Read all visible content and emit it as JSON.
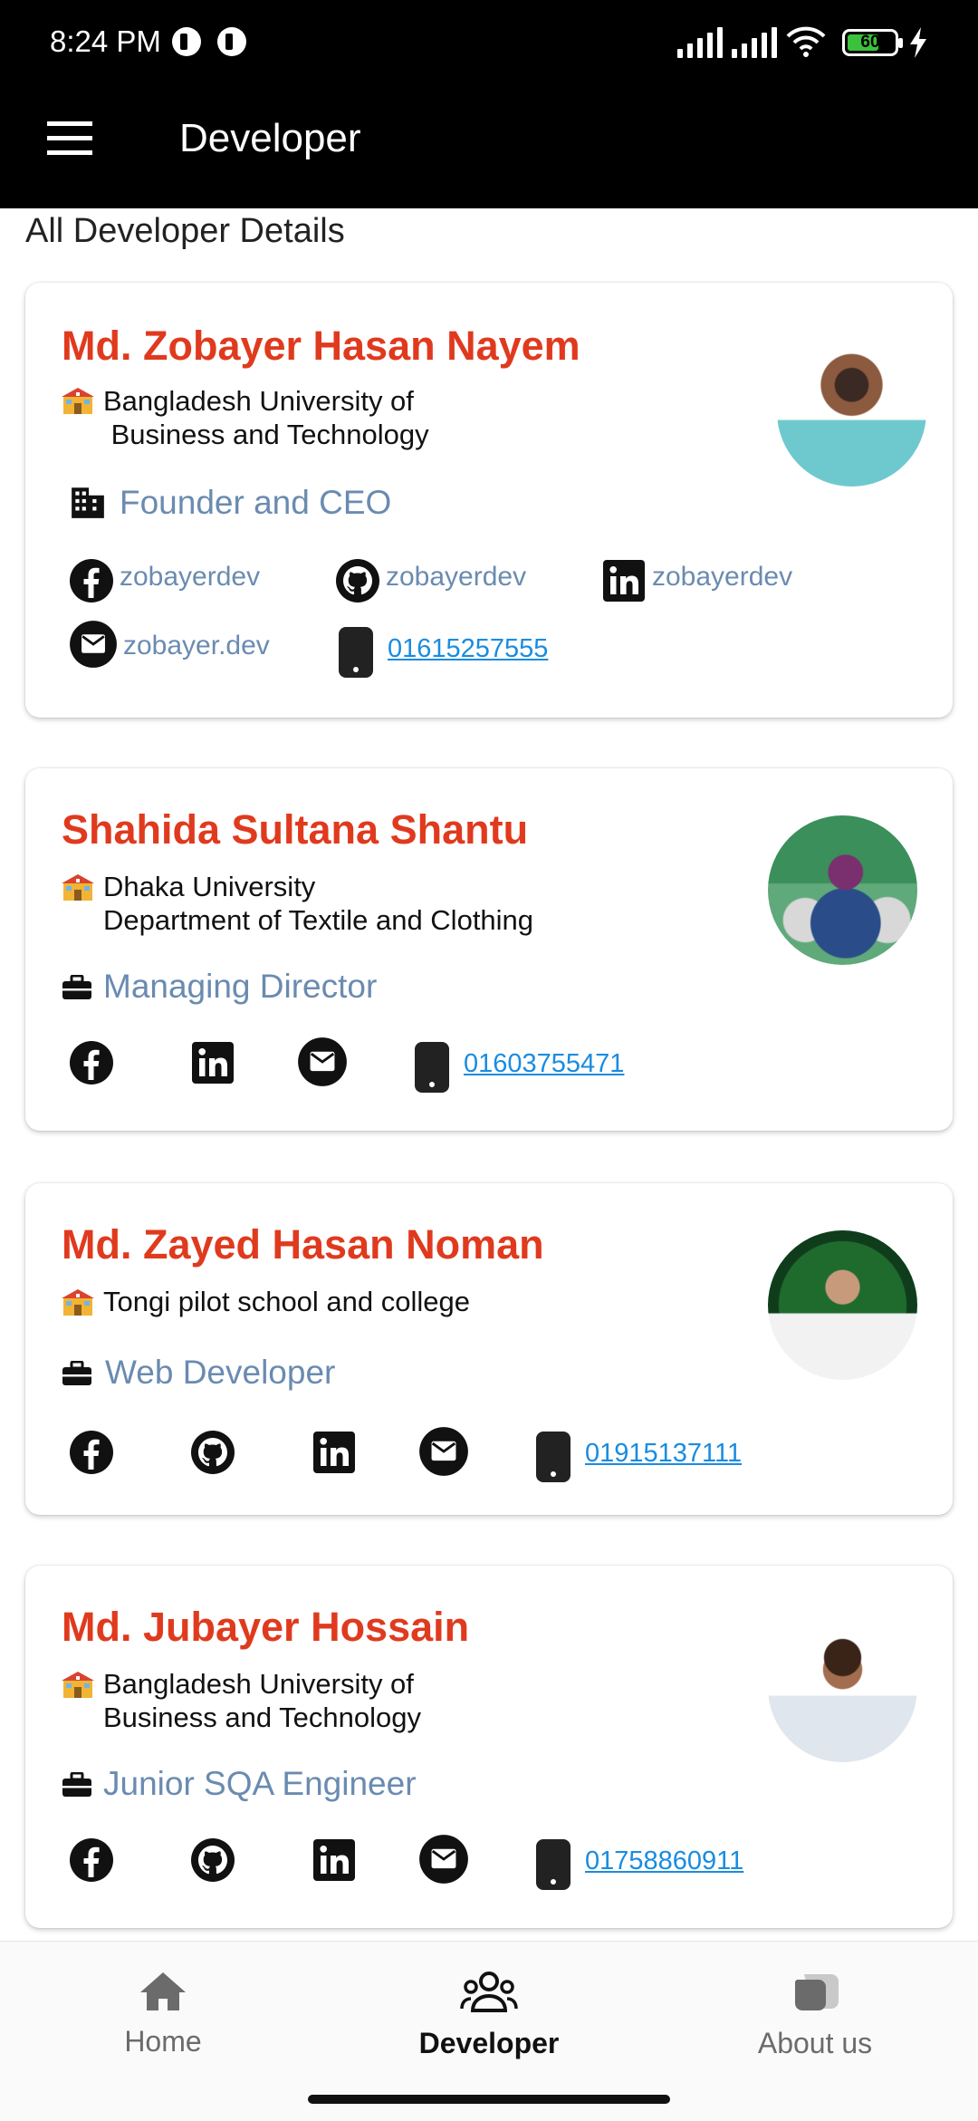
{
  "status_bar": {
    "time": "8:24 PM",
    "battery": "60"
  },
  "app_bar": {
    "title": "Developer"
  },
  "section_title": "All Developer Details",
  "developers": [
    {
      "name": "Md. Zobayer Hasan Nayem",
      "school": "Bangladesh University of\n Business and Technology",
      "role": "Founder and CEO",
      "facebook": "zobayerdev",
      "github": "zobayerdev",
      "linkedin": "zobayerdev",
      "email": "zobayer.dev",
      "phone": "01615257555"
    },
    {
      "name": "Shahida Sultana Shantu",
      "school": "Dhaka University\nDepartment of Textile and Clothing",
      "role": "Managing Director",
      "phone": "01603755471"
    },
    {
      "name": "Md. Zayed Hasan Noman",
      "school": "Tongi pilot school and college",
      "role": "Web Developer",
      "phone": "01915137111"
    },
    {
      "name": "Md. Jubayer Hossain",
      "school": "Bangladesh University of\nBusiness and Technology",
      "role": "Junior SQA Engineer",
      "phone": "01758860911"
    }
  ],
  "bottom_nav": {
    "home": "Home",
    "developer": "Developer",
    "about": "About us",
    "active": "Developer",
    "active_color": "#111111",
    "inactive_color": "#6b6b6b"
  },
  "colors": {
    "name": "#e03a1e",
    "role": "#6a8bb0",
    "link": "#1a8ce0",
    "appbar": "#000000"
  }
}
